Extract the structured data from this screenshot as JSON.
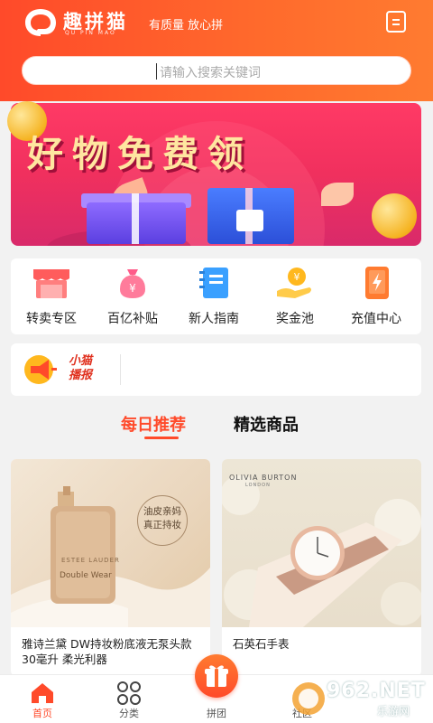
{
  "header": {
    "brand": "趣拼猫",
    "brand_sub": "QU PIN MAO",
    "slogan": "有质量 放心拼",
    "menu_icon": "menu-icon"
  },
  "search": {
    "placeholder": "请输入搜索关键词"
  },
  "banner": {
    "title": "好物免费领"
  },
  "categories": [
    {
      "label": "转卖专区",
      "icon": "shop-icon",
      "color": "#ff5c5c"
    },
    {
      "label": "百亿补贴",
      "icon": "money-bag-icon",
      "color": "#ff7b9b"
    },
    {
      "label": "新人指南",
      "icon": "guide-book-icon",
      "color": "#3aa0ff"
    },
    {
      "label": "奖金池",
      "icon": "coin-hand-icon",
      "color": "#ffb81e"
    },
    {
      "label": "充值中心",
      "icon": "phone-charge-icon",
      "color": "#ff7b30"
    }
  ],
  "notice": {
    "label_line1": "小猫",
    "label_line2": "播报",
    "icon": "megaphone-icon"
  },
  "tabs": [
    {
      "label": "每日推荐",
      "active": true
    },
    {
      "label": "精选商品",
      "active": false
    }
  ],
  "products": [
    {
      "title": "雅诗兰黛 DW持妆粉底液无泵头款 30毫升 柔光利器",
      "image_text": [
        "油皮亲妈",
        "真正持妆"
      ],
      "bottle_text": [
        "ESTEE LAUDER",
        "Double Wear"
      ]
    },
    {
      "title": "石英石手表",
      "image_text": [
        "OLIVIA BURTON",
        "LONDON"
      ]
    }
  ],
  "tabbar": [
    {
      "label": "首页",
      "icon": "home-icon",
      "active": true
    },
    {
      "label": "分类",
      "icon": "category-icon",
      "active": false
    },
    {
      "label": "拼团",
      "icon": "gift-icon",
      "active": false
    },
    {
      "label": "社区",
      "icon": "community-icon",
      "active": false
    }
  ],
  "watermark": {
    "text": "962.NET",
    "sub": "乐游网"
  },
  "colors": {
    "accent": "#ff4a2a",
    "banner": "#f0305e"
  }
}
